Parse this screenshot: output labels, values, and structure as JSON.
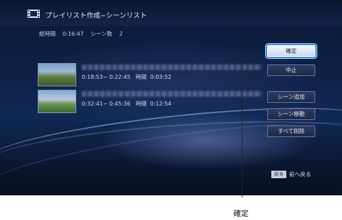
{
  "header": {
    "title": "プレイリスト作成−シーンリスト",
    "icon": "film-icon"
  },
  "summary": {
    "total_time_label": "総時間",
    "total_time_value": "0:16:47",
    "scene_count_label": "シーン数",
    "scene_count_value": "2"
  },
  "scenes": [
    {
      "time_range": "0:18:53− 0:22:45",
      "duration_label": "時間",
      "duration_value": "0:03:52"
    },
    {
      "time_range": "0:32:41− 0:45:36",
      "duration_label": "時間",
      "duration_value": "0:12:54"
    }
  ],
  "buttons": {
    "confirm": "確定",
    "cancel": "中止",
    "add_scene": "シーン追加",
    "move_scene": "シーン移動",
    "delete_all": "すべて削除"
  },
  "footer": {
    "back_key": "戻る",
    "back_label": "前へ戻る"
  },
  "callout": {
    "label": "確定"
  },
  "colors": {
    "background": "#0e2046",
    "selected_button_ring": "#3c8fe0",
    "button_border": "#6b7ba5"
  }
}
